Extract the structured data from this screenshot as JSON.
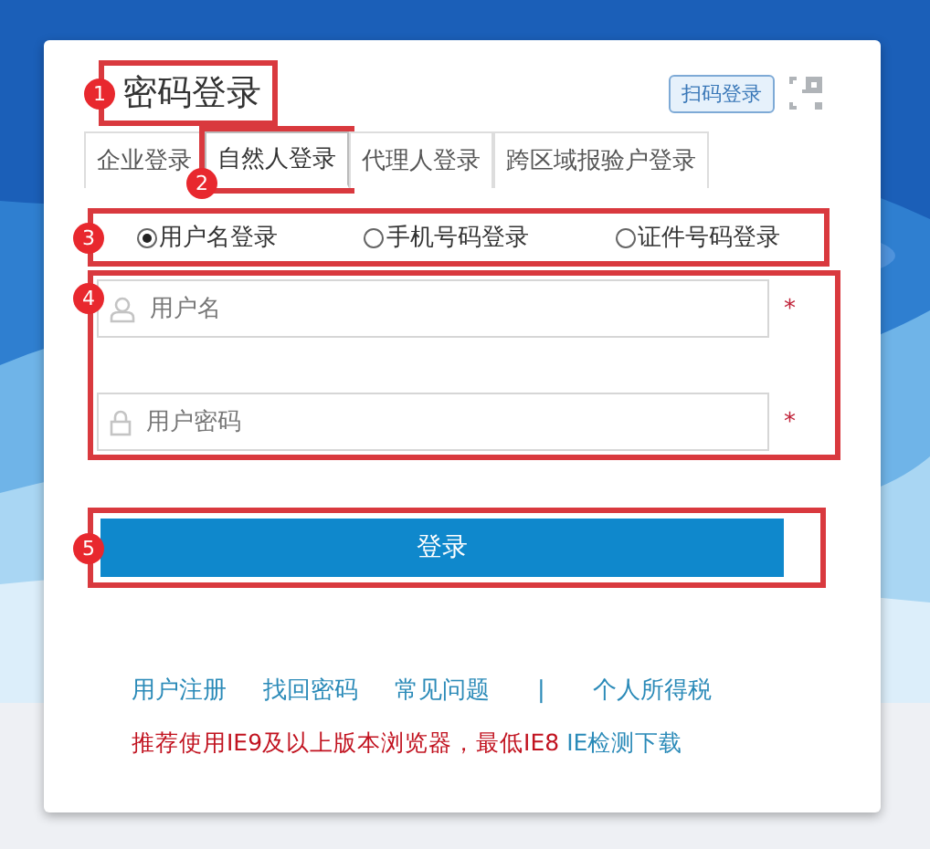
{
  "title": {
    "text": "密码登录",
    "annotation": "1"
  },
  "scan_login": {
    "label": "扫码登录"
  },
  "tabs": [
    {
      "label": "企业登录",
      "selected": false
    },
    {
      "label": "自然人登录",
      "selected": true,
      "annotation": "2"
    },
    {
      "label": "代理人登录",
      "selected": false
    },
    {
      "label": "跨区域报验户登录",
      "selected": false
    }
  ],
  "login_methods": {
    "annotation": "3",
    "options": [
      {
        "label": "用户名登录",
        "selected": true
      },
      {
        "label": "手机号码登录",
        "selected": false
      },
      {
        "label": "证件号码登录",
        "selected": false
      }
    ]
  },
  "fields": {
    "annotation": "4",
    "items": [
      {
        "kind": "user",
        "placeholder": "用户名",
        "required_mark": "*"
      },
      {
        "kind": "password",
        "placeholder": "用户密码",
        "required_mark": "*"
      }
    ]
  },
  "login_button": {
    "label": "登录",
    "annotation": "5"
  },
  "links": [
    {
      "text": "用户注册",
      "kind": "link"
    },
    {
      "text": "找回密码",
      "kind": "link"
    },
    {
      "text": "常见问题",
      "kind": "link"
    },
    {
      "text": "|",
      "kind": "separator"
    },
    {
      "text": "个人所得税",
      "kind": "link"
    }
  ],
  "notice": {
    "text": "推荐使用IE9及以上版本浏览器，最低IE8",
    "link": "IE检测下载"
  }
}
